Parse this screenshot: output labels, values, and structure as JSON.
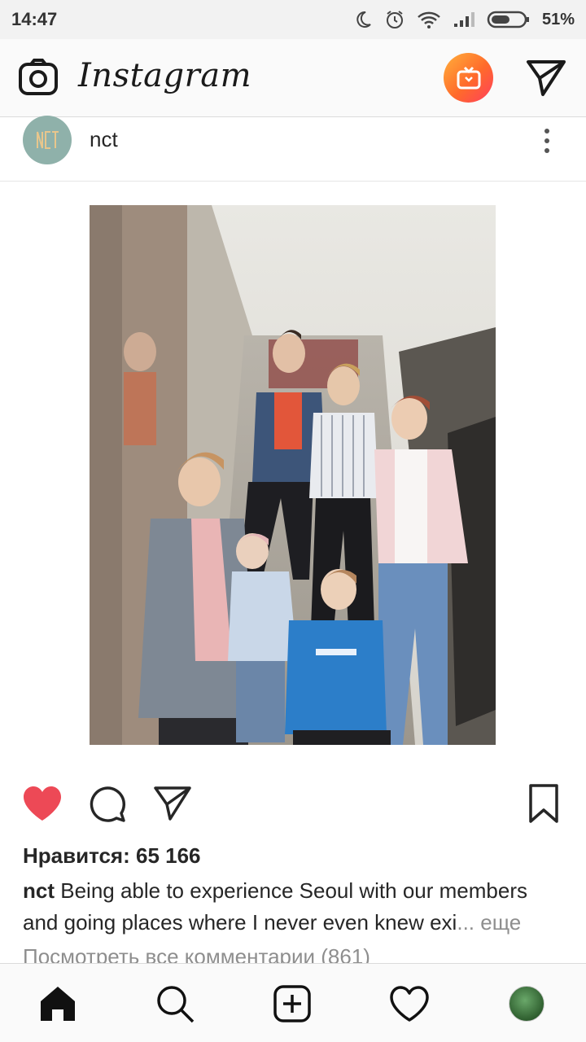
{
  "status_bar": {
    "time": "14:47",
    "battery_percent": "51%",
    "icons": [
      "moon-icon",
      "alarm-icon",
      "wifi-icon",
      "signal-icon",
      "battery-icon"
    ]
  },
  "header": {
    "logo_text": "Instagram",
    "icons": [
      "camera-icon",
      "igtv-icon",
      "direct-message-icon"
    ],
    "igtv_gradient": [
      "#ffb03b",
      "#ff6a2b",
      "#ff3e5e"
    ]
  },
  "post": {
    "username": "nct",
    "avatar_color": "#8fb1aa",
    "likes_text": "Нравится: 65 166",
    "caption": {
      "username": "nct",
      "text": "Being able to experience Seoul with our members and going places where I never even knew exi",
      "ellipsis": "...",
      "more": "еще"
    },
    "view_comments": "Посмотреть все комментарии (861)",
    "liked": true,
    "like_color": "#ed4956"
  },
  "actions": [
    "heart-icon",
    "comment-icon",
    "share-icon",
    "bookmark-icon"
  ],
  "bottom_nav": [
    "home-icon",
    "search-icon",
    "new-post-icon",
    "activity-icon",
    "profile-icon"
  ]
}
